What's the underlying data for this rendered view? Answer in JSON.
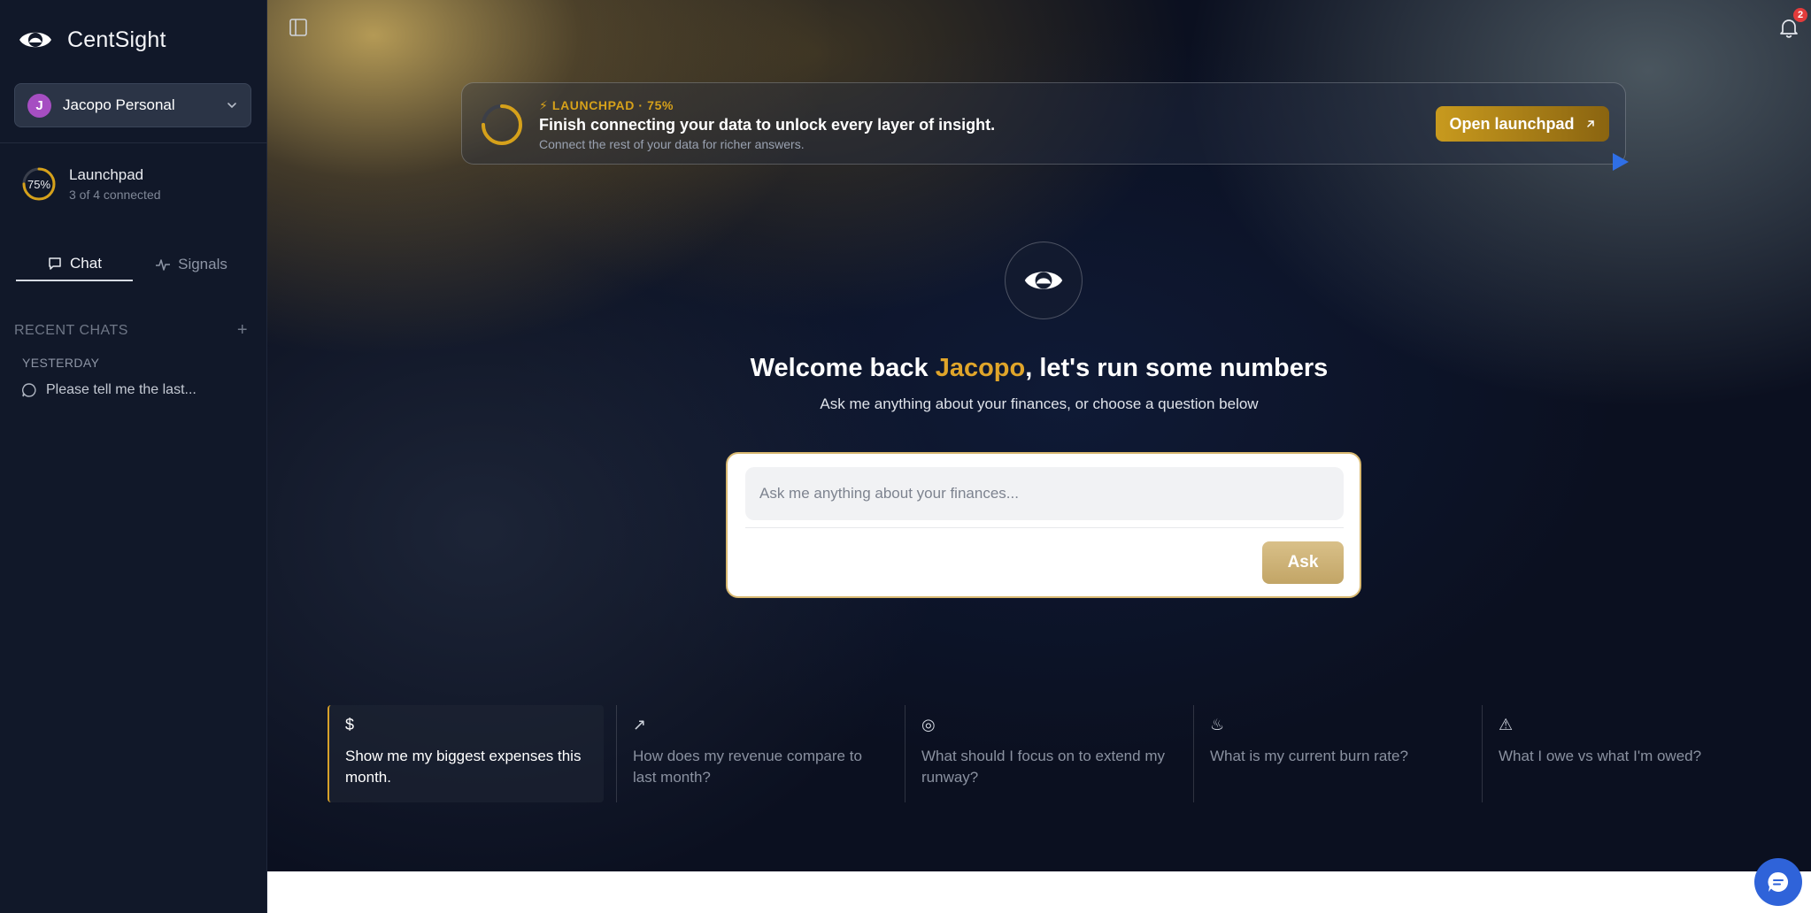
{
  "sidebar": {
    "brand": {
      "name": "CentSight",
      "icon": "eye-logo-icon"
    },
    "workspace": {
      "avatar_letter": "J",
      "name": "Jacopo Personal",
      "avatar_color": "#a64ec2"
    },
    "launchpad": {
      "percent_label": "75%",
      "percent": 75,
      "title": "Launchpad",
      "subtitle": "3 of 4 connected"
    },
    "tabs": [
      {
        "label": "Chat",
        "icon": "chat-bubble-icon",
        "active": true
      },
      {
        "label": "Signals",
        "icon": "activity-icon",
        "active": false
      }
    ],
    "recent": {
      "heading": "RECENT CHATS",
      "groups": [
        {
          "label": "YESTERDAY",
          "items": [
            {
              "title": "Please tell me the last..."
            }
          ]
        }
      ]
    }
  },
  "header": {
    "notifications": {
      "count": "2",
      "icon": "bell-icon"
    }
  },
  "banner": {
    "eyebrow": "⚡ LAUNCHPAD · 75%",
    "percent": 75,
    "title": "Finish connecting your data to unlock every layer of insight.",
    "subtitle": "Connect the rest of your data for richer answers.",
    "button_label": "Open launchpad",
    "accent": "#d6a11a"
  },
  "hero": {
    "greeting_prefix": "Welcome back ",
    "greeting_name": "Jacopo",
    "greeting_suffix": ", let's run some numbers",
    "subtitle": "Ask me anything about your finances, or choose a question below"
  },
  "ask": {
    "placeholder": "Ask me anything about your finances...",
    "button_label": "Ask"
  },
  "suggestions": [
    {
      "icon": "dollar-icon",
      "glyph": "$",
      "text": "Show me my biggest expenses this month.",
      "active": true
    },
    {
      "icon": "trending-up-icon",
      "glyph": "↗",
      "text": "How does my revenue compare to last month?",
      "active": false
    },
    {
      "icon": "target-icon",
      "glyph": "◎",
      "text": "What should I focus on to extend my runway?",
      "active": false
    },
    {
      "icon": "flame-icon",
      "glyph": "♨",
      "text": "What is my current burn rate?",
      "active": false
    },
    {
      "icon": "alert-triangle-icon",
      "glyph": "⚠",
      "text": "What I owe vs what I'm owed?",
      "active": false
    }
  ]
}
